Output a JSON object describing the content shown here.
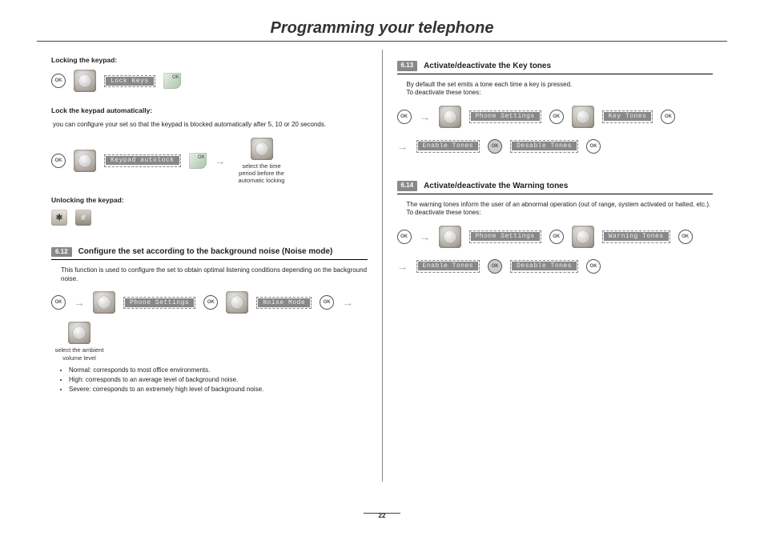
{
  "header": {
    "title": "Programming your telephone"
  },
  "left": {
    "sub_lock": "Locking the keypad:",
    "row_lock": {
      "lcd": "Lock Keys"
    },
    "sub_autolock": "Lock the keypad automatically:",
    "autolock_note": "you can configure your set so that the keypad is blocked automatically after 5, 10 or 20 seconds.",
    "row_autolock": {
      "lcd": "Keypad autolock",
      "caption": "select the time period before the automatic locking"
    },
    "sub_unlock": "Unlocking the keypad:",
    "sec612": {
      "num": "6.12",
      "title": "Configure the set according to the background noise (Noise mode)",
      "desc": "This function is used to configure the set to obtain optimal listening conditions depending on the background noise.",
      "lcd1": "Phone Settings",
      "lcd2": "Noise Mode",
      "caption": "select the ambient volume level",
      "bullets": [
        "Normal: corresponds to most office environments.",
        "High: corresponds to an average level of background noise.",
        "Severe: corresponds to an extremely high level of background noise."
      ]
    }
  },
  "right": {
    "sec613": {
      "num": "6.13",
      "title": "Activate/deactivate the Key tones",
      "desc1": "By default the set emits a tone each time a key is pressed.",
      "desc2": "To deactivate these tones:",
      "lcd1": "Phone Settings",
      "lcd2": "Key Tones",
      "lcd3": "Enable Tones",
      "lcd4": "Desable Tones"
    },
    "sec614": {
      "num": "6.14",
      "title": "Activate/deactivate the Warning tones",
      "desc1": "The warning tones inform the user of an abnormal operation (out of range, system activated or halted, etc.).",
      "desc2": "To deactivate these tones:",
      "lcd1": "Phone Settings",
      "lcd2": "Warning Tones",
      "lcd3": "Enable Tones",
      "lcd4": "Desable Tones"
    }
  },
  "common": {
    "ok": "OK",
    "hash": "#"
  },
  "page_number": "22"
}
